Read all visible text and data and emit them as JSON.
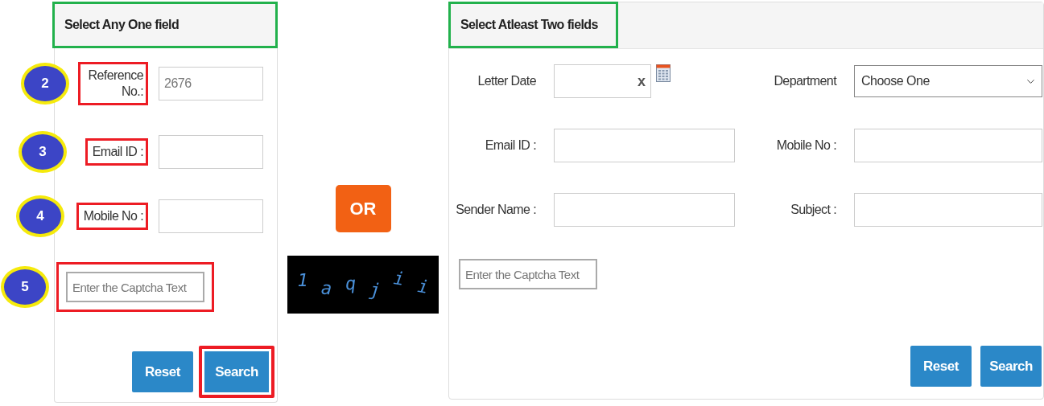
{
  "left_panel": {
    "title": "Select Any One field",
    "highlighted": true,
    "fields": [
      {
        "badge": "2",
        "label": "Reference No.:",
        "value": "2676",
        "highlighted": true
      },
      {
        "badge": "3",
        "label": "Email ID :",
        "highlighted": true
      },
      {
        "badge": "4",
        "label": "Mobile No :",
        "highlighted": true
      }
    ],
    "captcha_field": {
      "badge": "5",
      "placeholder": "Enter the Captcha Text",
      "highlighted": true
    },
    "buttons": [
      {
        "label": "Reset",
        "highlighted": false
      },
      {
        "label": "Search",
        "highlighted": true
      }
    ]
  },
  "separator": {
    "label": "OR"
  },
  "captcha_image": {
    "characters": [
      "1",
      "a",
      "q",
      "j",
      "i",
      "i"
    ]
  },
  "right_panel": {
    "title": "Select Atleast Two fields",
    "highlighted": true,
    "fields": [
      {
        "kind": "date",
        "label": "Letter Date",
        "clear": "x"
      },
      {
        "kind": "select",
        "label": "Department",
        "value": "Choose One"
      },
      {
        "kind": "text",
        "label": "Email ID :"
      },
      {
        "kind": "text",
        "label": "Mobile No :"
      },
      {
        "kind": "text",
        "label": "Sender Name :"
      },
      {
        "kind": "text",
        "label": "Subject :"
      }
    ],
    "captcha_field": {
      "placeholder": "Enter the Captcha Text"
    },
    "buttons": [
      {
        "label": "Reset"
      },
      {
        "label": "Search"
      }
    ]
  }
}
